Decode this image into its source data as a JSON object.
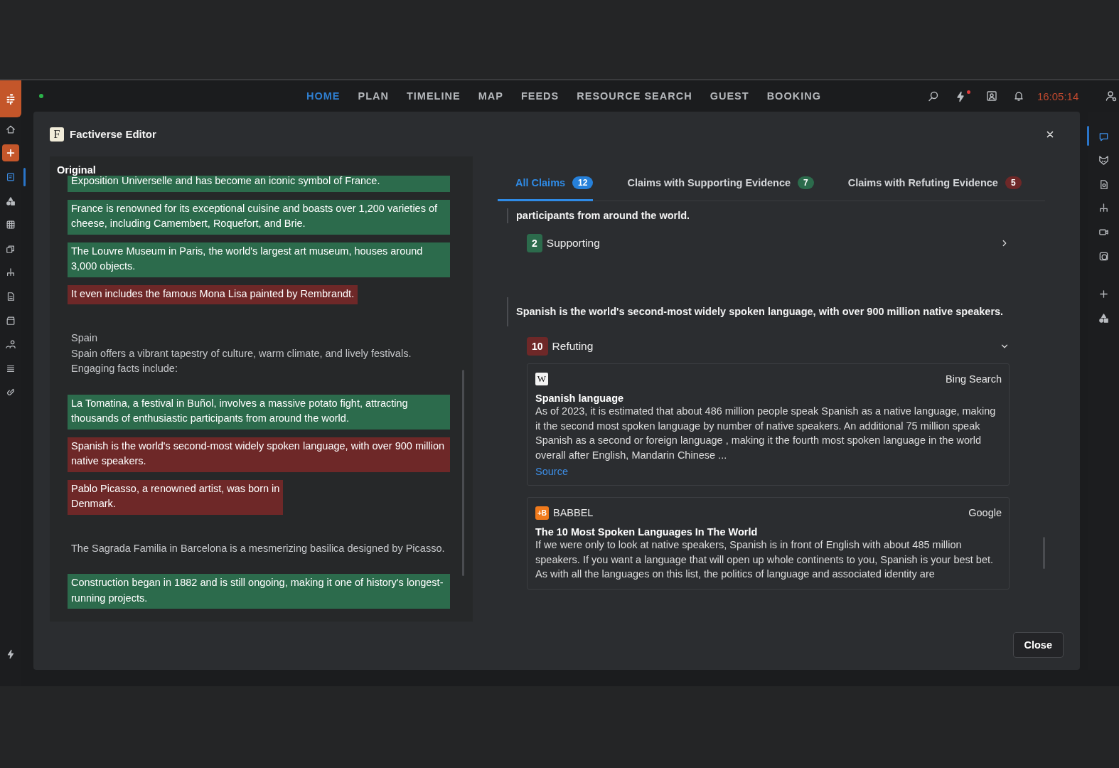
{
  "nav": {
    "items": [
      {
        "label": "HOME",
        "selected": true
      },
      {
        "label": "PLAN",
        "selected": false
      },
      {
        "label": "TIMELINE",
        "selected": false
      },
      {
        "label": "MAP",
        "selected": false
      },
      {
        "label": "FEEDS",
        "selected": false
      },
      {
        "label": "RESOURCE SEARCH",
        "selected": false
      },
      {
        "label": "GUEST",
        "selected": false
      },
      {
        "label": "BOOKING",
        "selected": false
      }
    ],
    "time": "16:05:14"
  },
  "left_sidebar": {
    "items": [
      {
        "selected": false
      },
      {
        "selected": false
      },
      {
        "selected": true
      },
      {
        "selected": false
      },
      {
        "selected": false
      },
      {
        "selected": false
      },
      {
        "selected": false
      },
      {
        "selected": false
      },
      {
        "selected": false
      },
      {
        "selected": false
      },
      {
        "selected": false
      },
      {
        "selected": false
      }
    ]
  },
  "right_sidebar": {
    "items": [
      {
        "selected": true
      },
      {
        "selected": false
      },
      {
        "selected": false
      },
      {
        "selected": false
      },
      {
        "selected": false
      },
      {
        "selected": false
      },
      {
        "selected": false
      },
      {
        "selected": false
      }
    ]
  },
  "modal": {
    "logo": "F",
    "title": "Factiverse Editor",
    "close_button": "Close",
    "original": {
      "title": "Original",
      "items": [
        {
          "kind": "claim",
          "color": "#2c6b4c",
          "text": "Exposition Universelle and has become an iconic symbol of France."
        },
        {
          "kind": "claim",
          "color": "#2c6b4c",
          "text": "France is renowned for its exceptional cuisine and boasts over 1,200 varieties of cheese, including Camembert, Roquefort, and Brie."
        },
        {
          "kind": "claim",
          "color": "#2c6b4c",
          "text": "The Louvre Museum in Paris, the world's largest art museum, houses around 3,000 objects."
        },
        {
          "kind": "claim",
          "color": "#6e2828",
          "text": "It even includes the famous Mona Lisa painted by Rembrandt."
        },
        {
          "kind": "text",
          "text": "Spain\nSpain offers a vibrant tapestry of culture, warm climate, and lively festivals. Engaging facts include:"
        },
        {
          "kind": "claim",
          "color": "#2c6b4c",
          "text": "La Tomatina, a festival in Buñol, involves a massive potato fight, attracting thousands of enthusiastic participants from around the world."
        },
        {
          "kind": "claim",
          "color": "#6e2828",
          "text": "Spanish is the world's second-most widely spoken language, with over 900 million native speakers."
        },
        {
          "kind": "claim",
          "color": "#6e2828",
          "text": "Pablo Picasso, a renowned artist, was born in\nDenmark."
        },
        {
          "kind": "text",
          "text": "The Sagrada Familia in Barcelona is a mesmerizing basilica designed by Picasso."
        },
        {
          "kind": "claim",
          "color": "#2c6b4c",
          "text": "Construction began in 1882 and is still ongoing, making it one of history's longest-running projects."
        }
      ]
    },
    "tabs": [
      {
        "label": "All Claims",
        "count": "12",
        "color": "#2680d9",
        "selected": true
      },
      {
        "label": "Claims with Supporting Evidence",
        "count": "7",
        "color": "#2c6b4c",
        "selected": false
      },
      {
        "label": "Claims with Refuting Evidence",
        "count": "5",
        "color": "#6e2828",
        "selected": false
      }
    ],
    "claims": [
      {
        "text": "participants from around the world.",
        "evidence": {
          "count": "2",
          "label": "Supporting",
          "color": "#2c6b4c",
          "expanded": false
        }
      },
      {
        "text": "Spanish is the world's second-most widely spoken language, with over 900 million native speakers.",
        "evidence": {
          "count": "10",
          "label": "Refuting",
          "color": "#6e2828",
          "expanded": true,
          "results": [
            {
              "logo": "W",
              "kind": "wiki",
              "provider": "Bing Search",
              "title": "Spanish language",
              "snippet": "As of 2023, it is estimated that about 486 million people speak Spanish as a native language, making it the second most spoken language by number of native speakers. An additional 75 million speak Spanish as a second or foreign language , making it the fourth most spoken language in the world overall after English, Mandarin Chinese ...",
              "link": "Source"
            },
            {
              "logo": "+B",
              "kind": "badge",
              "source": "BABBEL",
              "provider": "Google",
              "title": "The 10 Most Spoken Languages In The World",
              "snippet": "If we were only to look at native speakers, Spanish is in front of English with about 485 million speakers. If you want a language that will open up whole continents to you, Spanish is your best bet. As with all the languages on this list, the politics of language and associated identity are"
            }
          ]
        }
      }
    ]
  }
}
